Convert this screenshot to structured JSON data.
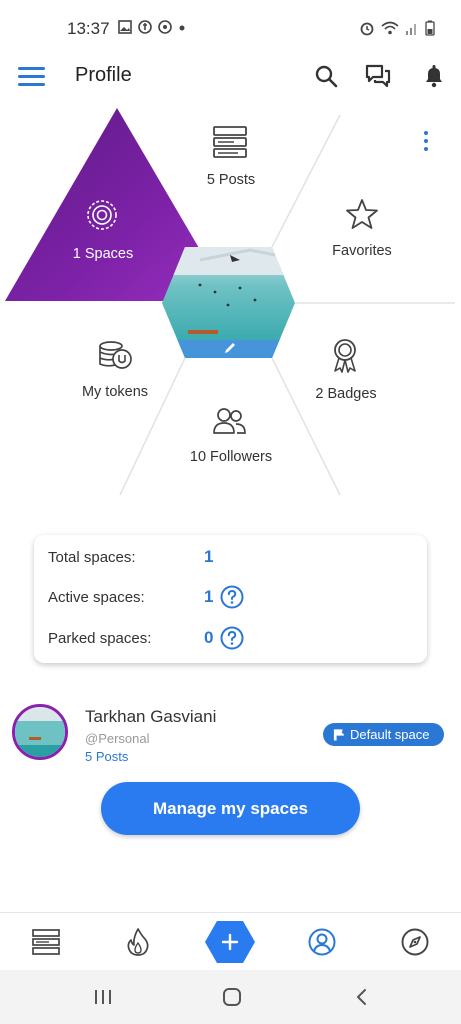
{
  "status_bar": {
    "time": "13:37"
  },
  "header": {
    "title": "Profile"
  },
  "hex_menu": {
    "posts": "5 Posts",
    "spaces": "1 Spaces",
    "favorites": "Favorites",
    "tokens": "My tokens",
    "badges": "2 Badges",
    "followers": "10 Followers"
  },
  "stats": {
    "total_label": "Total spaces:",
    "total_value": "1",
    "active_label": "Active spaces:",
    "active_value": "1",
    "parked_label": "Parked spaces:",
    "parked_value": "0"
  },
  "profile": {
    "name": "Tarkhan Gasviani",
    "handle": "@Personal",
    "posts": "5 Posts",
    "default_badge": "Default space"
  },
  "manage_button": "Manage my spaces",
  "colors": {
    "accent": "#2b78d4",
    "spaces_purple": "#7a1f9e",
    "button_blue": "#2b7bf0"
  },
  "icons": {
    "tabs": [
      "feed-icon",
      "fire-icon",
      "add-icon",
      "profile-icon",
      "compass-icon"
    ]
  }
}
